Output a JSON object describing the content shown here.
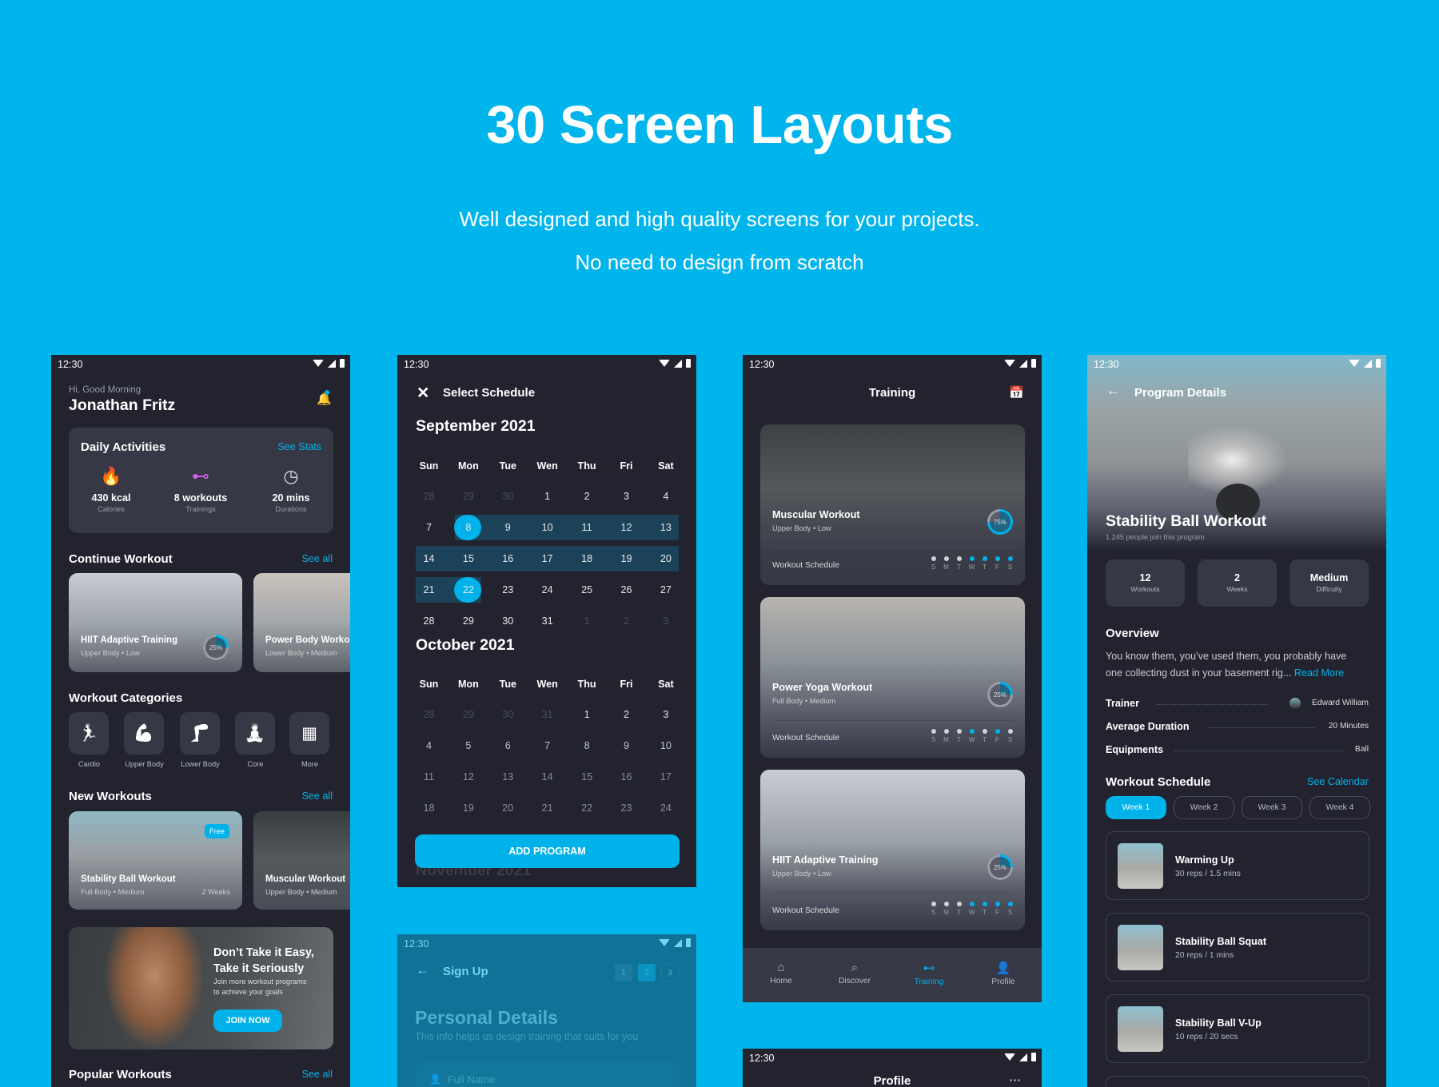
{
  "colors": {
    "page_bg": "#00b4ec",
    "accent": "#00b2ea",
    "phone_bg": "#22232f",
    "card_bg": "#363845"
  },
  "hero": {
    "title": "30 Screen Layouts",
    "subtitle_1": "Well designed and high quality screens for your projects.",
    "subtitle_2": "No need to design from scratch"
  },
  "status_time": "12:30",
  "home": {
    "greeting": "Hi, Good Morning",
    "name": "Jonathan Fritz",
    "daily": {
      "title": "Daily Activities",
      "link": "See Stats",
      "stats": [
        {
          "icon": "flame-icon",
          "glyph": "🔥",
          "value": "430 kcal",
          "label": "Calories"
        },
        {
          "icon": "dumbbell-icon",
          "glyph": "⊷",
          "value": "8 workouts",
          "label": "Trainings"
        },
        {
          "icon": "clock-icon",
          "glyph": "◷",
          "value": "20 mins",
          "label": "Durations"
        }
      ]
    },
    "continue": {
      "title": "Continue Workout",
      "link": "See all",
      "cards": [
        {
          "title": "HIIT Adaptive Training",
          "sub": "Upper Body • Low",
          "progress": "25%",
          "pct": 25
        },
        {
          "title": "Power Body Workout",
          "sub": "Lower Body • Medium"
        }
      ]
    },
    "categories": {
      "title": "Workout Categories",
      "items": [
        {
          "label": "Cardio",
          "icon": "running-icon",
          "glyph": "🏃"
        },
        {
          "label": "Upper Body",
          "icon": "upper-body-icon",
          "glyph": "💪"
        },
        {
          "label": "Lower Body",
          "icon": "lower-body-icon",
          "glyph": "🦵"
        },
        {
          "label": "Core",
          "icon": "core-icon",
          "glyph": "🧘"
        },
        {
          "label": "More",
          "icon": "grid-icon",
          "glyph": "▦"
        }
      ]
    },
    "new": {
      "title": "New Workouts",
      "link": "See all",
      "cards": [
        {
          "title": "Stability Ball Workout",
          "sub": "Full Body • Medium",
          "duration": "2 Weeks",
          "badge": "Free"
        },
        {
          "title": "Muscular Workout",
          "sub": "Upper Body • Medium"
        }
      ]
    },
    "banner": {
      "title_1": "Don’t Take it Easy,",
      "title_2": "Take it Seriously",
      "text_1": "Join more workout programs",
      "text_2": "to achieve your goals",
      "button": "JOIN NOW"
    },
    "popular": {
      "title": "Popular Workouts",
      "link": "See all"
    }
  },
  "schedule": {
    "title": "Select Schedule",
    "weekdays": [
      "Sun",
      "Mon",
      "Tue",
      "Wen",
      "Thu",
      "Fri",
      "Sat"
    ],
    "months": [
      {
        "name": "September 2021",
        "weeks": [
          [
            "28",
            "29",
            "30",
            "1",
            "2",
            "3",
            "4"
          ],
          [
            "7",
            "8",
            "9",
            "10",
            "11",
            "12",
            "13"
          ],
          [
            "14",
            "15",
            "16",
            "17",
            "18",
            "19",
            "20"
          ],
          [
            "21",
            "22",
            "23",
            "24",
            "25",
            "26",
            "27"
          ],
          [
            "28",
            "29",
            "30",
            "31",
            "1",
            "2",
            "3"
          ]
        ],
        "range_start": "8",
        "range_end": "22"
      },
      {
        "name": "October 2021",
        "weeks": [
          [
            "28",
            "29",
            "30",
            "31",
            "1",
            "2",
            "3"
          ],
          [
            "4",
            "5",
            "6",
            "7",
            "8",
            "9",
            "10"
          ],
          [
            "11",
            "12",
            "13",
            "14",
            "15",
            "16",
            "17"
          ],
          [
            "18",
            "19",
            "20",
            "21",
            "22",
            "23",
            "24"
          ]
        ]
      }
    ],
    "next_month": "November 2021",
    "button": "ADD PROGRAM"
  },
  "signup": {
    "title": "Sign Up",
    "steps": [
      "1",
      "2",
      "3"
    ],
    "active_step": "2",
    "heading": "Personal Details",
    "subheading": "This info helps us design training that suits for you",
    "name_placeholder": "Full Name"
  },
  "training": {
    "title": "Training",
    "schedule_label": "Workout Schedule",
    "days": [
      "S",
      "M",
      "T",
      "W",
      "T",
      "F",
      "S"
    ],
    "cards": [
      {
        "title": "Muscular Workout",
        "sub": "Upper Body • Low",
        "progress": "75%",
        "pct": 75,
        "active_days": [
          false,
          false,
          false,
          true,
          true,
          true,
          true
        ]
      },
      {
        "title": "Power Yoga Workout",
        "sub": "Full Body • Medium",
        "progress": "25%",
        "pct": 25,
        "active_days": [
          false,
          false,
          false,
          true,
          false,
          true,
          false
        ]
      },
      {
        "title": "HIIT Adaptive Training",
        "sub": "Upper Body • Low",
        "progress": "25%",
        "pct": 25,
        "active_days": [
          false,
          false,
          false,
          true,
          true,
          true,
          true
        ]
      }
    ],
    "nav": [
      {
        "label": "Home",
        "icon": "home-icon",
        "glyph": "⌂"
      },
      {
        "label": "Discover",
        "icon": "search-icon",
        "glyph": "⌕"
      },
      {
        "label": "Training",
        "icon": "dumbbell-icon",
        "glyph": "⊷",
        "active": true
      },
      {
        "label": "Profile",
        "icon": "profile-icon",
        "glyph": "👤"
      }
    ]
  },
  "profile": {
    "title": "Profile"
  },
  "program": {
    "header": "Program Details",
    "title": "Stability Ball Workout",
    "sub": "1.245 people join this program",
    "stats": [
      {
        "value": "12",
        "label": "Workouts"
      },
      {
        "value": "2",
        "label": "Weeks"
      },
      {
        "value": "Medium",
        "label": "Difficulty"
      }
    ],
    "overview_title": "Overview",
    "overview_1": "You know them, you’ve used them, you probably have",
    "overview_2": "one collecting dust in your basement rig...",
    "read_more": "Read More",
    "details": [
      {
        "label": "Trainer",
        "value": "Edward William"
      },
      {
        "label": "Average Duration",
        "value": "20 Minutes"
      },
      {
        "label": "Equipments",
        "value": "Ball"
      }
    ],
    "schedule_title": "Workout Schedule",
    "schedule_link": "See Calendar",
    "weeks": [
      "Week 1",
      "Week 2",
      "Week 3",
      "Week 4"
    ],
    "exercises": [
      {
        "name": "Warming Up",
        "meta": "30 reps / 1.5 mins"
      },
      {
        "name": "Stability Ball Squat",
        "meta": "20 reps / 1 mins"
      },
      {
        "name": "Stability Ball V-Up",
        "meta": "10 reps / 20 secs"
      }
    ]
  }
}
